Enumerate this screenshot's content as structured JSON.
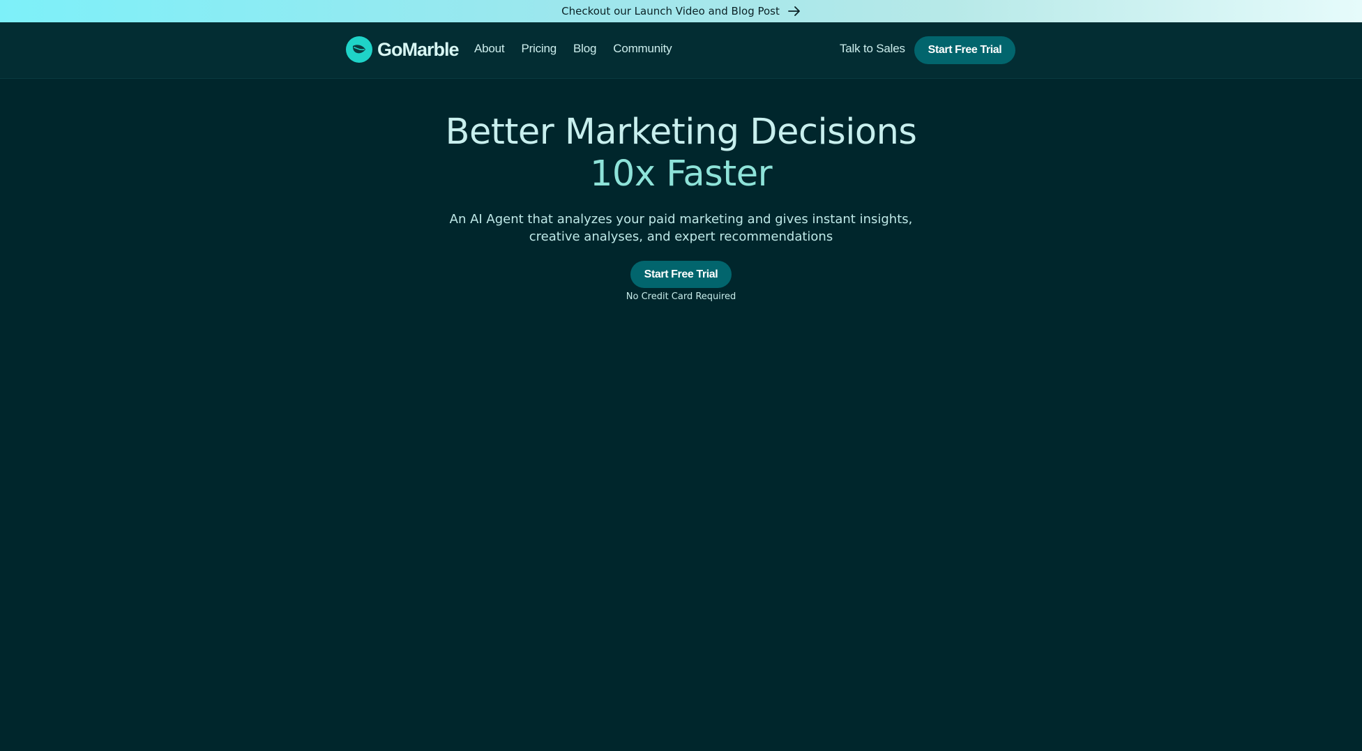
{
  "announcement": {
    "text": "Checkout our Launch Video and Blog Post",
    "icon": "arrow-right-icon"
  },
  "nav": {
    "brand": "GoMarble",
    "brand_icon": "leaf-icon",
    "links": [
      "About",
      "Pricing",
      "Blog",
      "Community"
    ],
    "talk_to_sales": "Talk to Sales",
    "cta": "Start Free Trial"
  },
  "hero": {
    "title_line1": "Better Marketing Decisions",
    "title_line2": "10x Faster",
    "subtitle_line1": "An AI Agent that analyzes your paid marketing and gives instant insights,",
    "subtitle_line2": "creative analyses, and expert recommendations",
    "cta": "Start Free Trial",
    "note": "No Credit Card Required"
  },
  "colors": {
    "background": "#00262c",
    "navbar": "#032d33",
    "button": "#02656d",
    "accent": "#8ee3d9",
    "logo": "#1fd3c8"
  }
}
